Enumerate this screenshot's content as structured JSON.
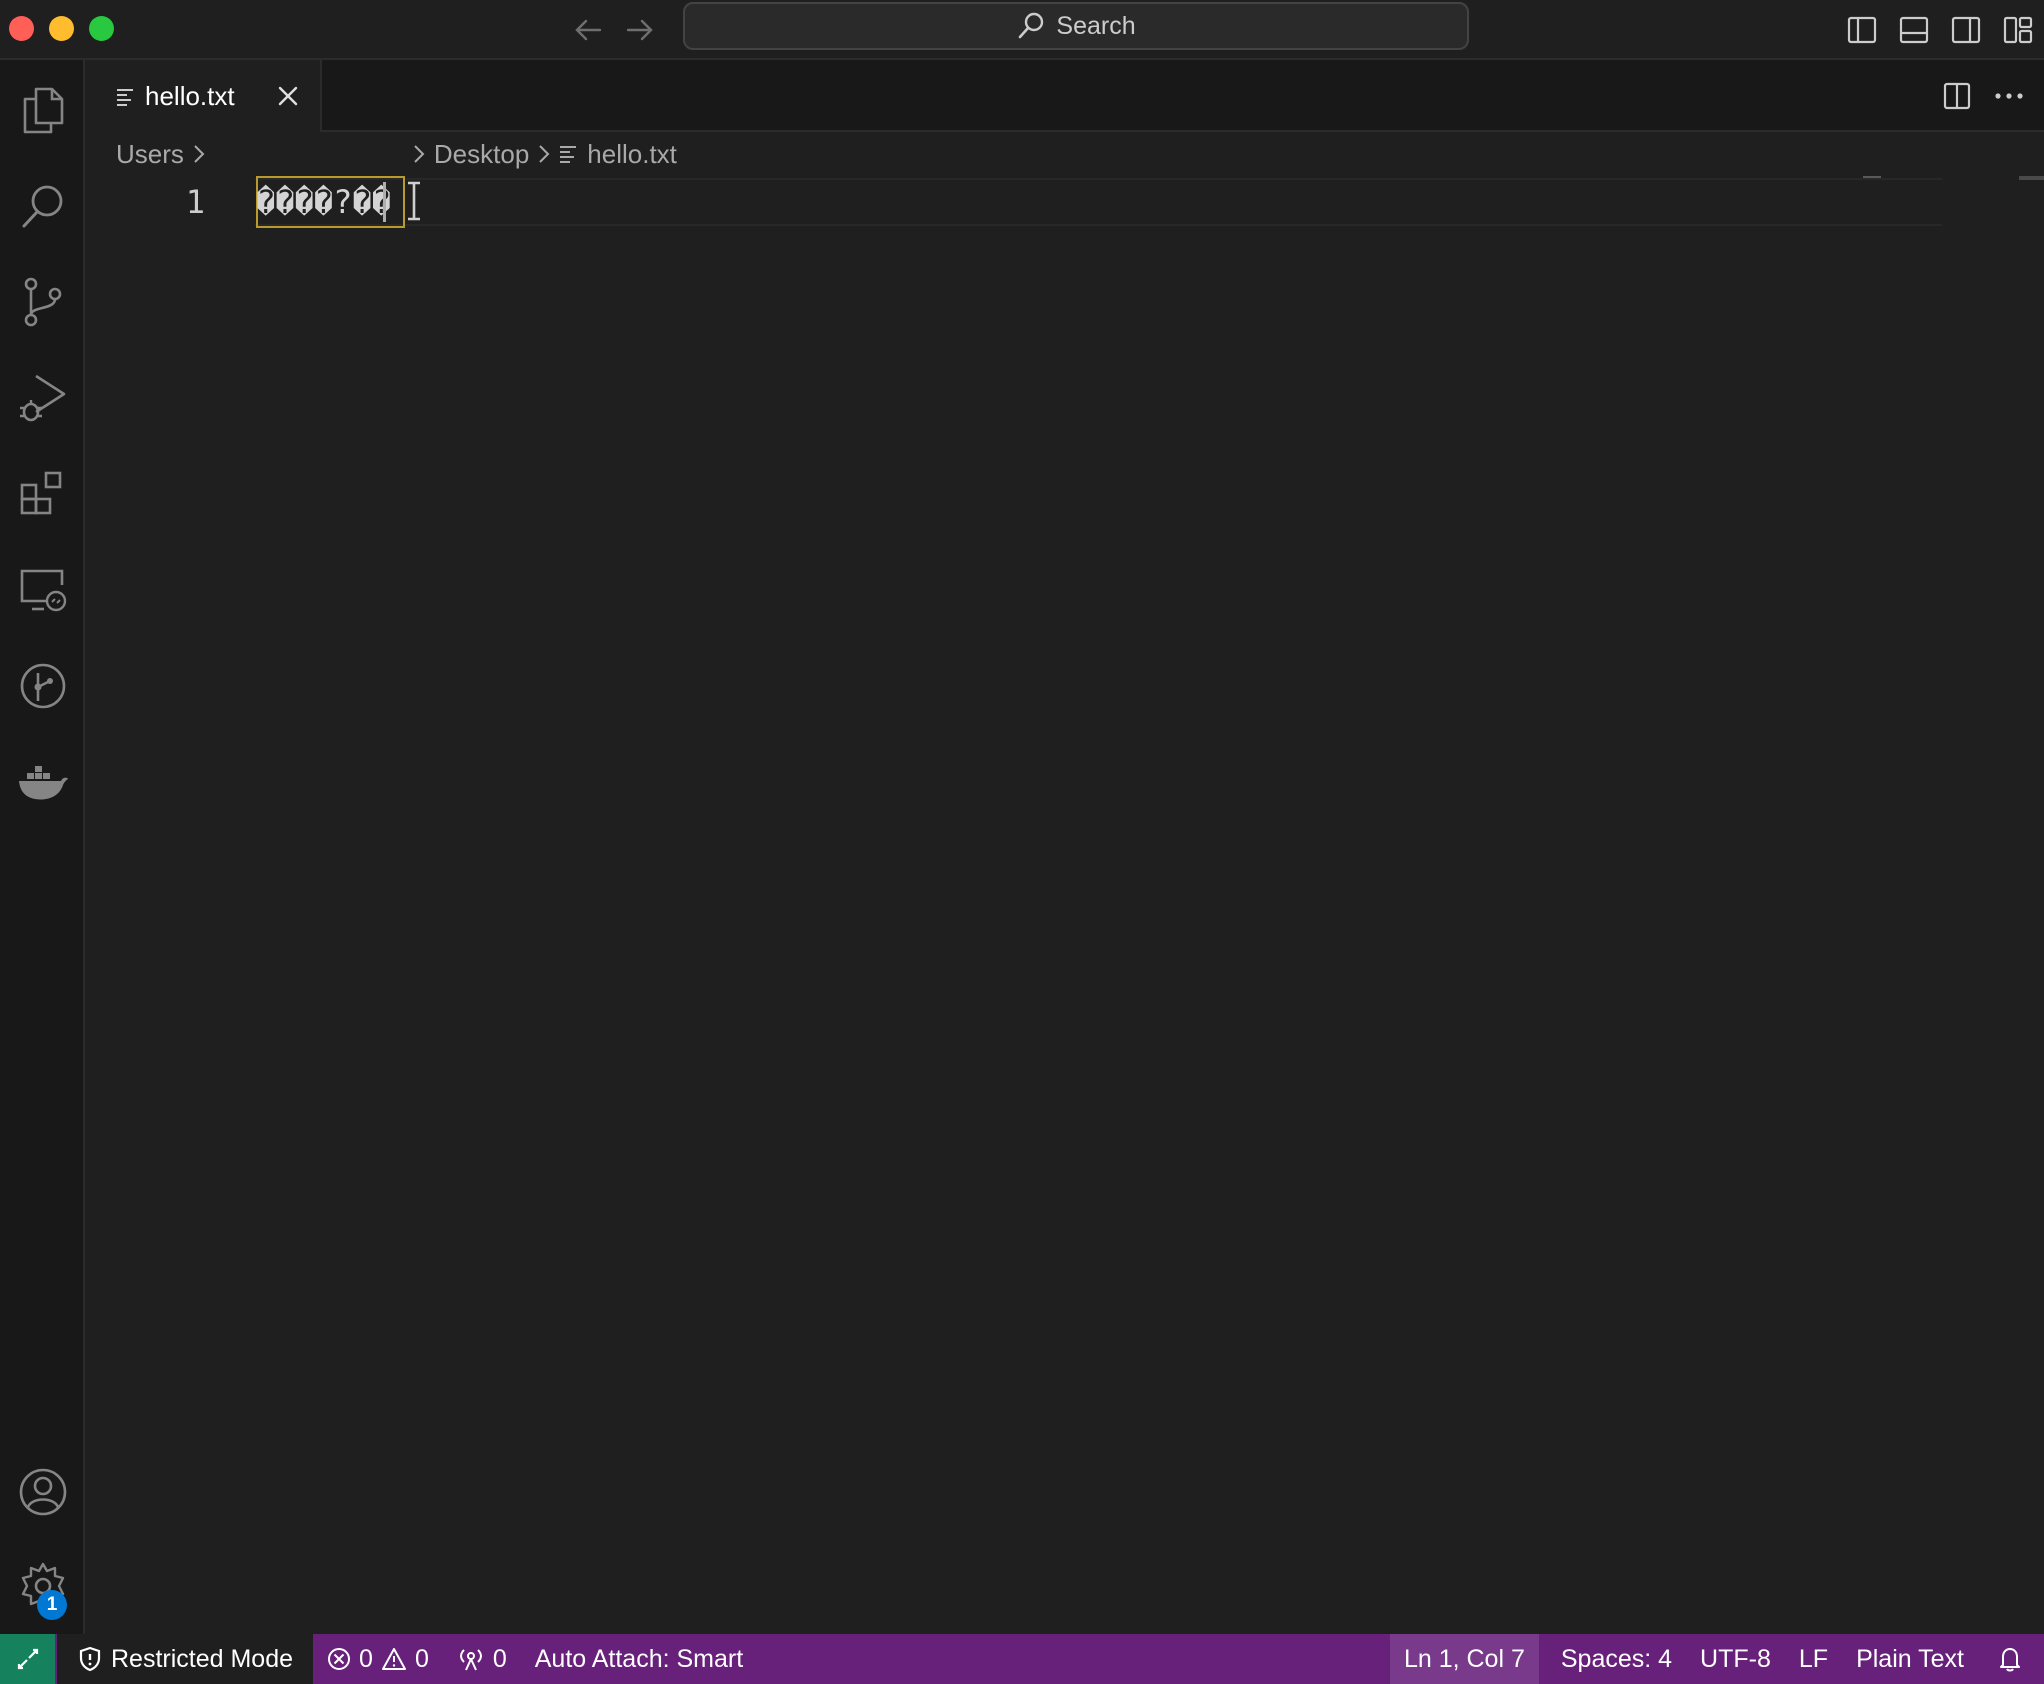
{
  "titlebar": {
    "search_label": "Search"
  },
  "tabs": [
    {
      "label": "hello.txt",
      "active": true
    }
  ],
  "breadcrumb": {
    "items": [
      "Users",
      "Desktop",
      "hello.txt"
    ]
  },
  "editor": {
    "line_number": "1",
    "line_text": "����?��",
    "cursor_line": 1,
    "cursor_col": 7
  },
  "activity_bar": {
    "items": [
      "explorer-icon",
      "search-icon",
      "source-control-icon",
      "run-debug-icon",
      "extensions-icon",
      "remote-explorer-icon",
      "git-graph-icon",
      "docker-icon"
    ],
    "bottom": [
      "accounts-icon",
      "manage-gear-icon"
    ],
    "manage_badge": "1"
  },
  "statusbar": {
    "restricted_mode": "Restricted Mode",
    "errors": "0",
    "warnings": "0",
    "ports": "0",
    "auto_attach": "Auto Attach: Smart",
    "position": "Ln 1, Col 7",
    "spaces": "Spaces: 4",
    "encoding": "UTF-8",
    "eol": "LF",
    "language": "Plain Text"
  },
  "colors": {
    "statusbar_bg": "#68217a",
    "remote_bg": "#16825d",
    "editor_bg": "#1f1f1f",
    "badge_bg": "#0078d4",
    "highlight_border": "#b89a2f"
  }
}
